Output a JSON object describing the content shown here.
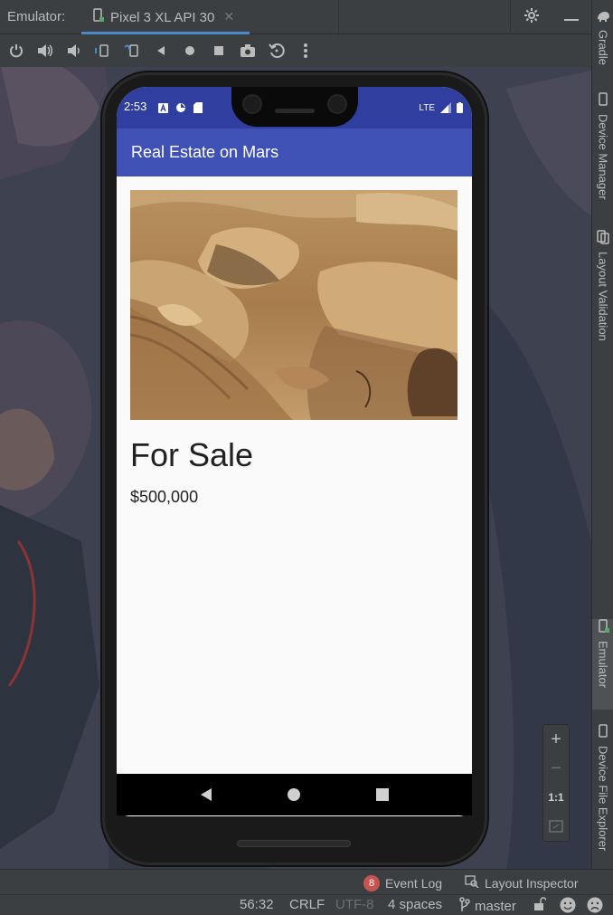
{
  "window": {
    "title_prefix": "Emulator:",
    "tab_label": "Pixel 3 XL API 30"
  },
  "toolbar": {
    "icons": [
      "power-icon",
      "volume-up-icon",
      "volume-down-icon",
      "rotate-left-icon",
      "rotate-right-icon",
      "back-icon",
      "home-icon",
      "overview-icon",
      "camera-icon",
      "reset-icon",
      "more-icon"
    ]
  },
  "right_tools": [
    {
      "label": "Gradle",
      "active": false
    },
    {
      "label": "Device Manager",
      "active": false
    },
    {
      "label": "Layout Validation",
      "active": false
    },
    {
      "label": "Emulator",
      "active": true
    },
    {
      "label": "Device File Explorer",
      "active": false
    }
  ],
  "phone": {
    "status_time": "2:53",
    "status_network": "LTE",
    "app_title": "Real Estate on Mars",
    "listing_type": "For Sale",
    "price": "$500,000"
  },
  "zoom": {
    "plus": "+",
    "minus": "−",
    "actual": "1:1"
  },
  "bottom_tools": {
    "event_log_count": "8",
    "event_log_label": "Event Log",
    "layout_inspector_label": "Layout Inspector"
  },
  "status": {
    "position": "56:32",
    "line_sep": "CRLF",
    "encoding": "UTF-8",
    "indent": "4 spaces",
    "branch": "master"
  },
  "colors": {
    "app_bar": "#3f51b5",
    "status_bar": "#303f9f",
    "ide_bg": "#3c3f41",
    "tab_underline": "#4a88c7",
    "badge": "#c75450"
  }
}
